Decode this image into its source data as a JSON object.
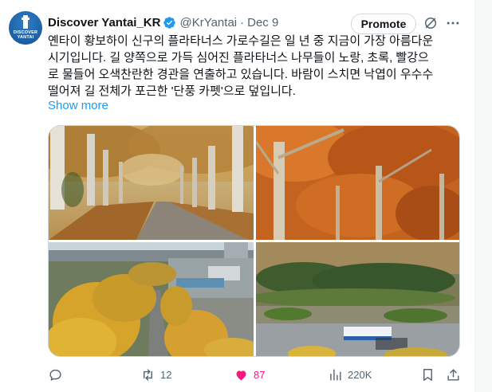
{
  "colors": {
    "accent": "#1d9bf0",
    "like": "#f91880",
    "muted": "#536471",
    "text": "#0f1419"
  },
  "avatar": {
    "lines": [
      "DISCOVER",
      "YANTAI"
    ]
  },
  "author": {
    "display_name": "Discover Yantai_KR",
    "handle": "@KrYantai",
    "separator": "·",
    "date": "Dec 9",
    "verified": true
  },
  "header_actions": {
    "promote_label": "Promote",
    "grok_icon": "grok-icon",
    "more_icon": "more-icon"
  },
  "tweet": {
    "lines": [
      "옌타이 황보하이 신구의 플라타너스 가로수길은 일 년 중 지금이 가장 아름다운",
      "시기입니다. 길 양쪽으로 가득 심어진 플라타너스 나무들이 노랑, 초록, 빨강으",
      "로 물들어 오색찬란한 경관을 연출하고 있습니다. 바람이 스치면 낙엽이 우수수",
      "떨어져 길 전체가 포근한 '단풍 카펫'으로 덮입니다."
    ],
    "show_more": "Show more"
  },
  "media": [
    {
      "subject": "plane-tree avenue with fallen leaves"
    },
    {
      "subject": "orange autumn foliage canopy"
    },
    {
      "subject": "aerial view of golden tree-lined road"
    },
    {
      "subject": "overhead view of road with bus"
    }
  ],
  "metrics": {
    "replies": "",
    "retweets": "12",
    "likes": "87",
    "views": "220K"
  },
  "icons": [
    "reply-icon",
    "retweet-icon",
    "heart-icon",
    "views-icon",
    "bookmark-icon",
    "share-icon"
  ]
}
